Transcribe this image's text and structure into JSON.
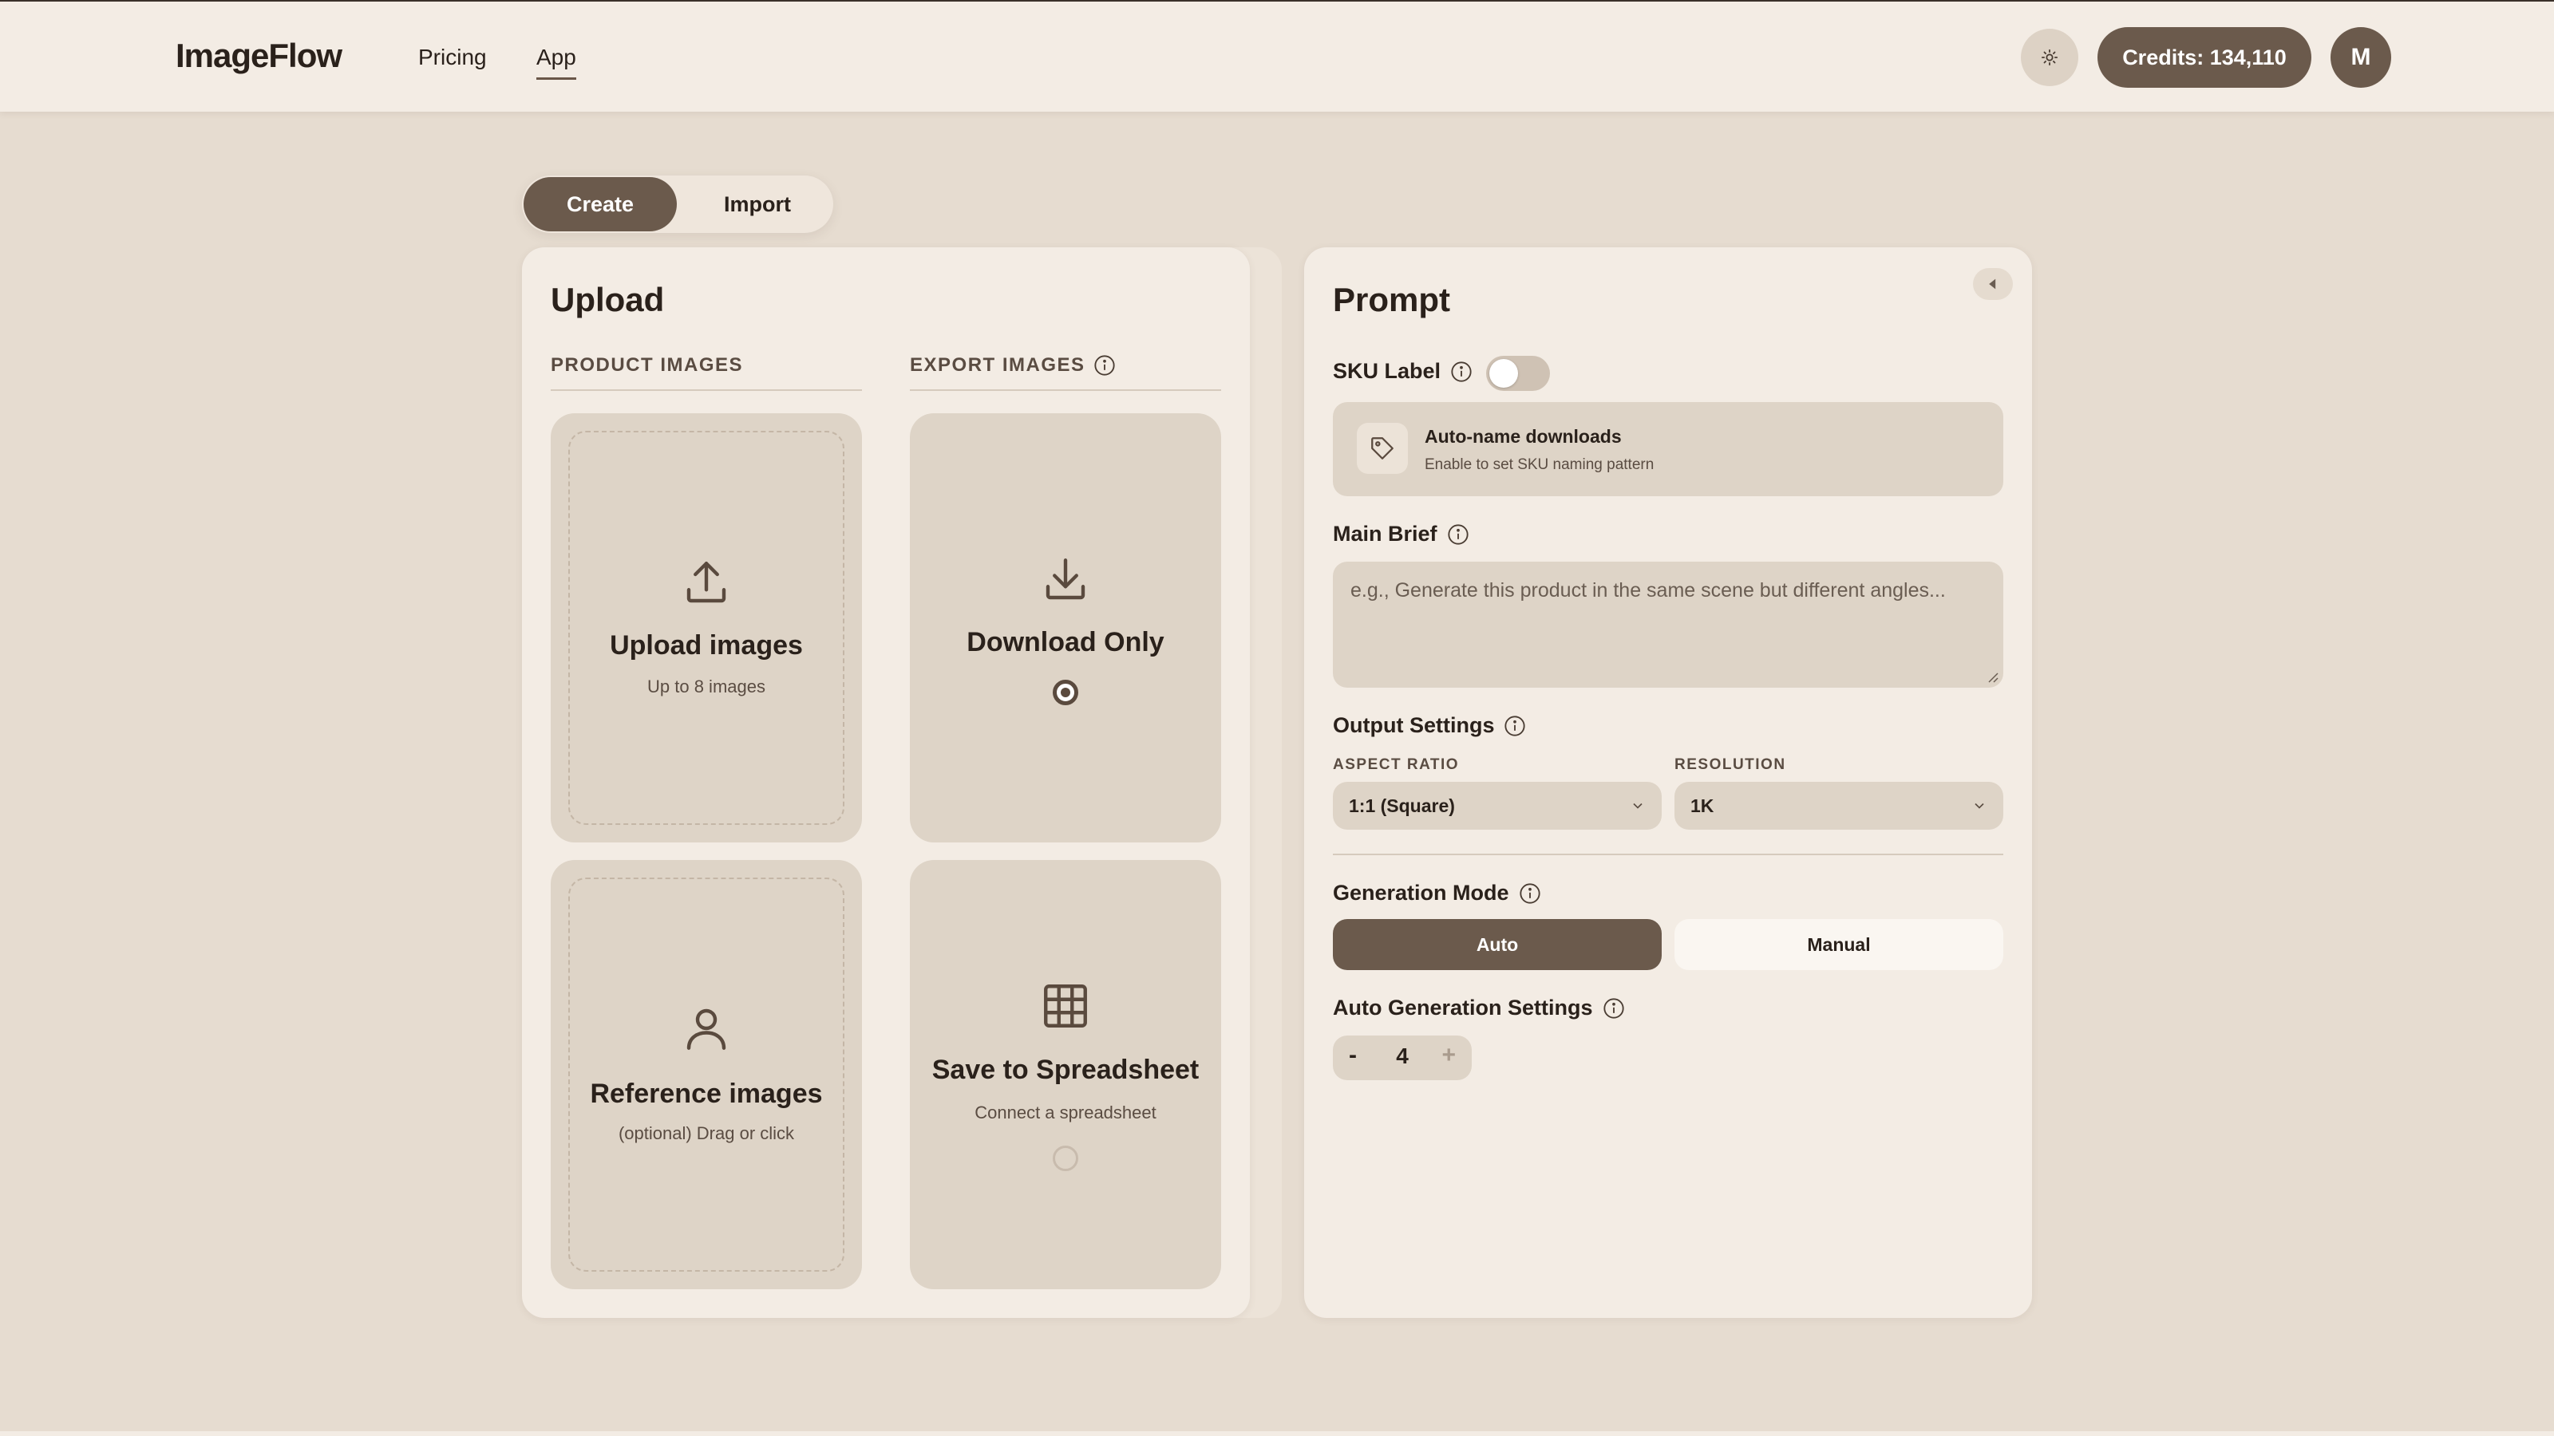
{
  "header": {
    "logo": "ImageFlow",
    "nav": {
      "pricing": "Pricing",
      "app": "App"
    },
    "theme_icon": "sun-icon",
    "credits_label": "Credits: 134,110",
    "avatar_initial": "M"
  },
  "tabs": {
    "create": "Create",
    "import": "Import",
    "active": "Create"
  },
  "upload": {
    "title": "Upload",
    "product_images_label": "PRODUCT IMAGES",
    "export_images_label": "EXPORT IMAGES",
    "upload_card": {
      "title": "Upload images",
      "subtitle": "Up to 8 images",
      "icon": "upload-icon"
    },
    "reference_card": {
      "title": "Reference images",
      "subtitle": "(optional) Drag or click",
      "icon": "user-icon"
    },
    "download_card": {
      "title": "Download Only",
      "icon": "download-icon",
      "selected": true
    },
    "spreadsheet_card": {
      "title": "Save to Spreadsheet",
      "subtitle": "Connect a spreadsheet",
      "icon": "grid-icon",
      "selected": false
    }
  },
  "prompt": {
    "title": "Prompt",
    "sku_label": "SKU Label",
    "sku_toggle_on": false,
    "sku_box": {
      "title": "Auto-name downloads",
      "subtitle": "Enable to set SKU naming pattern",
      "icon": "tag-icon"
    },
    "main_brief_label": "Main Brief",
    "main_brief_placeholder": "e.g., Generate this product in the same scene but different angles...",
    "main_brief_value": "",
    "output_settings_label": "Output Settings",
    "aspect_ratio_label": "ASPECT RATIO",
    "aspect_ratio_value": "1:1 (Square)",
    "resolution_label": "RESOLUTION",
    "resolution_value": "1K",
    "generation_mode_label": "Generation Mode",
    "mode_auto": "Auto",
    "mode_manual": "Manual",
    "mode_active": "Auto",
    "auto_settings_label": "Auto Generation Settings",
    "stepper": {
      "minus": "-",
      "value": "4",
      "plus": "+"
    }
  },
  "colors": {
    "background": "#e6dcd0",
    "panel": "#f3ece4",
    "card": "#ded4c7",
    "accent": "#6b5a4c",
    "text": "#2a211b"
  }
}
